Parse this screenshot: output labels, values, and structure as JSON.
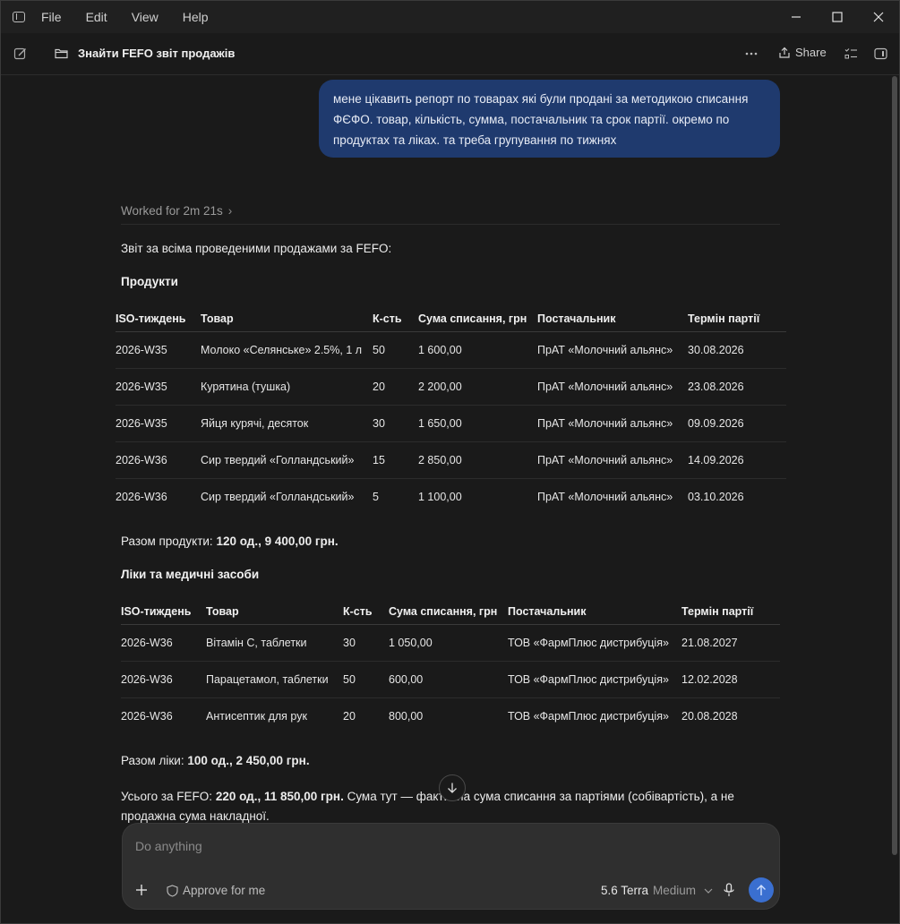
{
  "menu": [
    "File",
    "Edit",
    "View",
    "Help"
  ],
  "toolbar": {
    "title": "Знайти FEFO звіт продажів",
    "share_label": "Share"
  },
  "user_message": "мене цікавить репорт по товарах які були продані за методикою списання ФЄФО. товар, кількість,  сумма, постачальник та срок партії. окремо по продуктах та ліках. та треба групування по тижнях",
  "worked": "Worked for 2m 21s",
  "intro": "Звіт за всіма проведеними продажами за FEFO:",
  "products": {
    "heading": "Продукти",
    "columns": [
      "ISO-тиждень",
      "Товар",
      "К-сть",
      "Сума списання, грн",
      "Постачальник",
      "Термін партії"
    ],
    "rows": [
      [
        "2026-W35",
        "Молоко «Селянське» 2.5%, 1 л",
        "50",
        "1 600,00",
        "ПрАТ «Молочний альянс»",
        "30.08.2026"
      ],
      [
        "2026-W35",
        "Курятина (тушка)",
        "20",
        "2 200,00",
        "ПрАТ «Молочний альянс»",
        "23.08.2026"
      ],
      [
        "2026-W35",
        "Яйця курячі, десяток",
        "30",
        "1 650,00",
        "ПрАТ «Молочний альянс»",
        "09.09.2026"
      ],
      [
        "2026-W36",
        "Сир твердий «Голландський»",
        "15",
        "2 850,00",
        "ПрАТ «Молочний альянс»",
        "14.09.2026"
      ],
      [
        "2026-W36",
        "Сир твердий «Голландський»",
        "5",
        "1 100,00",
        "ПрАТ «Молочний альянс»",
        "03.10.2026"
      ]
    ],
    "total_label": "Разом продукти: ",
    "total_value": "120 од., 9 400,00 грн."
  },
  "medicine": {
    "heading": "Ліки та медичні засоби",
    "columns": [
      "ISO-тиждень",
      "Товар",
      "К-сть",
      "Сума списання, грн",
      "Постачальник",
      "Термін партії"
    ],
    "rows": [
      [
        "2026-W36",
        "Вітамін C, таблетки",
        "30",
        "1 050,00",
        "ТОВ «ФармПлюс дистрибуція»",
        "21.08.2027"
      ],
      [
        "2026-W36",
        "Парацетамол, таблетки",
        "50",
        "600,00",
        "ТОВ «ФармПлюс дистрибуція»",
        "12.02.2028"
      ],
      [
        "2026-W36",
        "Антисептик для рук",
        "20",
        "800,00",
        "ТОВ «ФармПлюс дистрибуція»",
        "20.08.2028"
      ]
    ],
    "total_label": "Разом ліки: ",
    "total_value": "100 од., 2 450,00 грн."
  },
  "grand_total": {
    "label": "Усього за FEFO: ",
    "value": "220 од., 11 850,00 грн.",
    "note_line1": " Сума тут — фактична сума списання за партіями (собівартість), а не",
    "note_line2": "продажна сума накладної."
  },
  "composer": {
    "placeholder": "Do anything",
    "approve_label": "Approve for me",
    "model_name": "5.6 Terra",
    "model_effort": "Medium"
  }
}
